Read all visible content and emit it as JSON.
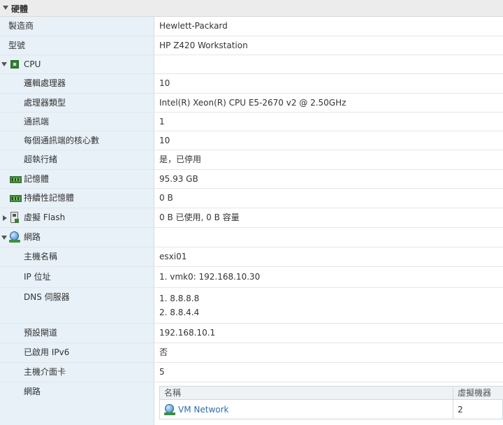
{
  "section": {
    "title": "硬體"
  },
  "rows": {
    "manufacturer": {
      "label": "製造商",
      "value": "Hewlett-Packard"
    },
    "model": {
      "label": "型號",
      "value": "HP Z420 Workstation"
    },
    "cpu": {
      "label": "CPU",
      "value": ""
    },
    "logical_processors": {
      "label": "邏輯處理器",
      "value": "10"
    },
    "processor_type": {
      "label": "處理器類型",
      "value": "Intel(R) Xeon(R) CPU E5-2670 v2 @ 2.50GHz"
    },
    "sockets": {
      "label": "通訊端",
      "value": "1"
    },
    "cores_per_socket": {
      "label": "每個通訊端的核心數",
      "value": "10"
    },
    "hyperthreading": {
      "label": "超執行緒",
      "value": "是，已停用"
    },
    "memory": {
      "label": "記憶體",
      "value": "95.93 GB"
    },
    "persistent_memory": {
      "label": "持續性記憶體",
      "value": "0 B"
    },
    "virtual_flash": {
      "label": "虛擬 Flash",
      "value": "0 B 已使用, 0 B 容量"
    },
    "network": {
      "label": "網路",
      "value": ""
    },
    "hostname": {
      "label": "主機名稱",
      "value": "esxi01"
    },
    "ip_address": {
      "label": "IP 位址",
      "value": "1. vmk0: 192.168.10.30"
    },
    "dns_servers": {
      "label": "DNS 伺服器",
      "values": [
        "1. 8.8.8.8",
        "2. 8.8.4.4"
      ]
    },
    "default_gateway": {
      "label": "預設閘道",
      "value": "192.168.10.1"
    },
    "ipv6_enabled": {
      "label": "已啟用 IPv6",
      "value": "否"
    },
    "host_nics": {
      "label": "主機介面卡",
      "value": "5"
    },
    "networks": {
      "label": "網路"
    }
  },
  "network_table": {
    "headers": [
      "名稱",
      "虛擬機器"
    ],
    "rows": [
      {
        "name": "VM Network",
        "vm_count": "2"
      }
    ]
  },
  "icons": {
    "cpu": "cpu-chip-icon",
    "memory": "memory-module-icon",
    "persistent_memory": "memory-module-icon",
    "virtual_flash": "flash-device-icon",
    "network": "network-globe-icon"
  }
}
